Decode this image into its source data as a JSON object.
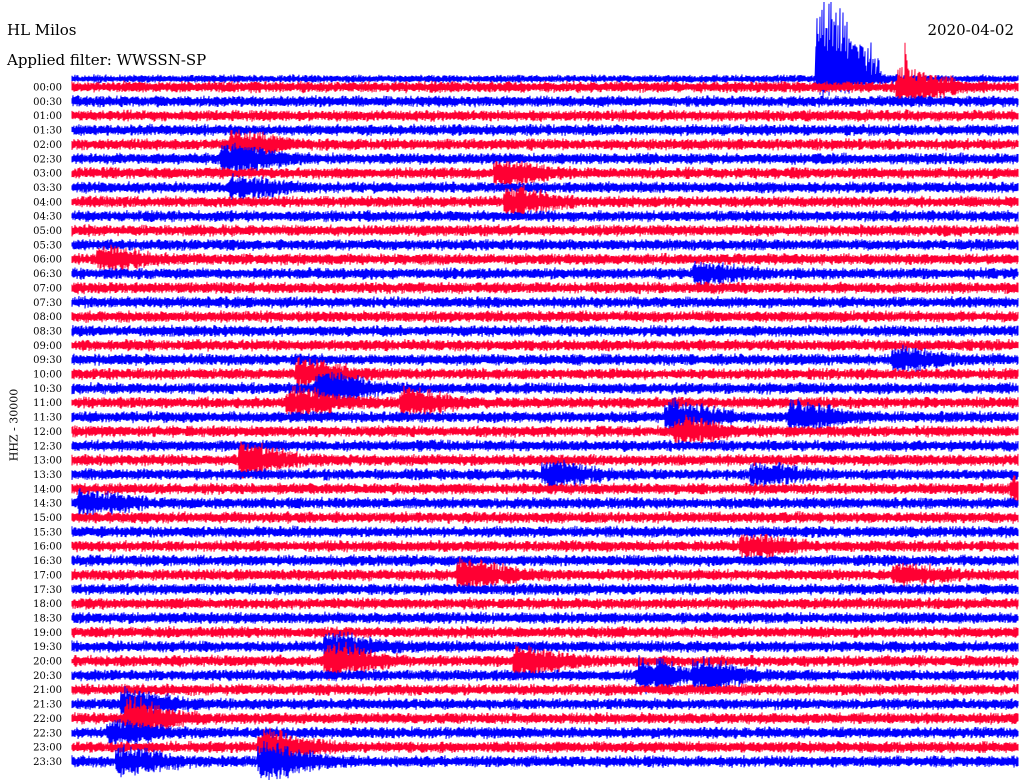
{
  "header": {
    "station": "HL Milos",
    "filter": "Applied filter: WWSSN-SP",
    "date": "2020-04-02"
  },
  "chart_data": {
    "type": "line",
    "title": "HL Milos",
    "subtitle": "Applied filter: WWSSN-SP",
    "date": "2020-04-02",
    "ylabel": "HHZ - 30000",
    "xlabel": "",
    "series_colors": [
      "#ff0033",
      "#0000ff"
    ],
    "rows": [
      "00:00",
      "00:30",
      "01:00",
      "01:30",
      "02:00",
      "02:30",
      "03:00",
      "03:30",
      "04:00",
      "04:30",
      "05:00",
      "05:30",
      "06:00",
      "06:30",
      "07:00",
      "07:30",
      "08:00",
      "08:30",
      "09:00",
      "09:30",
      "10:00",
      "10:30",
      "11:00",
      "11:30",
      "12:00",
      "12:30",
      "13:00",
      "13:30",
      "14:00",
      "14:30",
      "15:00",
      "15:30",
      "16:00",
      "16:30",
      "17:00",
      "17:30",
      "18:00",
      "18:30",
      "19:00",
      "19:30",
      "20:00",
      "20:30",
      "21:00",
      "21:30",
      "22:00",
      "22:30",
      "23:00",
      "23:30"
    ],
    "events": [
      {
        "row": -1,
        "pos": 0.79,
        "amp": 4.2
      },
      {
        "row": 0,
        "pos": 0.875,
        "amp": 2.6
      },
      {
        "row": 4,
        "pos": 0.17,
        "amp": 1.8
      },
      {
        "row": 5,
        "pos": 0.16,
        "amp": 2.2
      },
      {
        "row": 6,
        "pos": 0.45,
        "amp": 1.6
      },
      {
        "row": 7,
        "pos": 0.17,
        "amp": 1.6
      },
      {
        "row": 8,
        "pos": 0.46,
        "amp": 2.0
      },
      {
        "row": 12,
        "pos": 0.03,
        "amp": 1.5
      },
      {
        "row": 13,
        "pos": 0.66,
        "amp": 1.4
      },
      {
        "row": 19,
        "pos": 0.87,
        "amp": 1.5
      },
      {
        "row": 20,
        "pos": 0.24,
        "amp": 2.0
      },
      {
        "row": 21,
        "pos": 0.26,
        "amp": 2.6
      },
      {
        "row": 22,
        "pos": 0.23,
        "amp": 2.2
      },
      {
        "row": 22,
        "pos": 0.35,
        "amp": 1.8
      },
      {
        "row": 23,
        "pos": 0.63,
        "amp": 2.2
      },
      {
        "row": 23,
        "pos": 0.76,
        "amp": 2.0
      },
      {
        "row": 24,
        "pos": 0.64,
        "amp": 1.8
      },
      {
        "row": 26,
        "pos": 0.18,
        "amp": 2.2
      },
      {
        "row": 27,
        "pos": 0.5,
        "amp": 1.7
      },
      {
        "row": 27,
        "pos": 0.72,
        "amp": 1.6
      },
      {
        "row": 28,
        "pos": 0.995,
        "amp": 2.0
      },
      {
        "row": 29,
        "pos": 0.01,
        "amp": 1.6
      },
      {
        "row": 32,
        "pos": 0.71,
        "amp": 1.5
      },
      {
        "row": 34,
        "pos": 0.41,
        "amp": 2.4
      },
      {
        "row": 34,
        "pos": 0.87,
        "amp": 1.4
      },
      {
        "row": 39,
        "pos": 0.27,
        "amp": 1.8
      },
      {
        "row": 40,
        "pos": 0.27,
        "amp": 2.4
      },
      {
        "row": 40,
        "pos": 0.47,
        "amp": 2.2
      },
      {
        "row": 41,
        "pos": 0.6,
        "amp": 2.4
      },
      {
        "row": 41,
        "pos": 0.66,
        "amp": 2.0
      },
      {
        "row": 43,
        "pos": 0.055,
        "amp": 2.2
      },
      {
        "row": 44,
        "pos": 0.06,
        "amp": 2.6
      },
      {
        "row": 45,
        "pos": 0.04,
        "amp": 1.6
      },
      {
        "row": 46,
        "pos": 0.2,
        "amp": 2.4
      },
      {
        "row": 47,
        "pos": 0.2,
        "amp": 2.6
      },
      {
        "row": 47,
        "pos": 0.05,
        "amp": 2.0
      }
    ]
  }
}
